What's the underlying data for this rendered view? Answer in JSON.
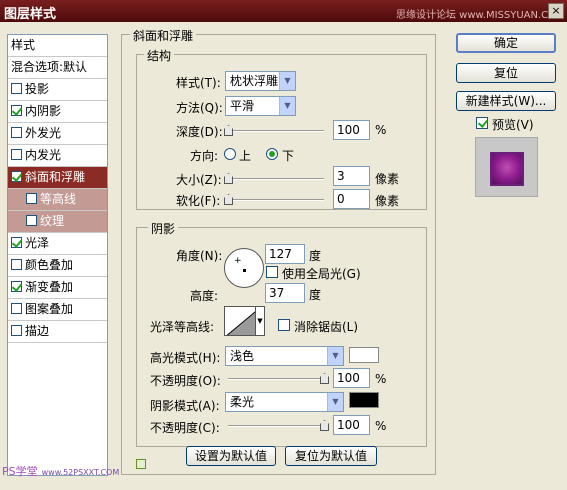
{
  "window": {
    "title": "图层样式",
    "watermark": "思缘设计论坛 www.MISSYUAN.COM",
    "close": "×"
  },
  "style_list": {
    "header": "样式",
    "blend_options": "混合选项:默认",
    "items": [
      {
        "label": "投影",
        "checked": false
      },
      {
        "label": "内阴影",
        "checked": true
      },
      {
        "label": "外发光",
        "checked": false
      },
      {
        "label": "内发光",
        "checked": false
      },
      {
        "label": "斜面和浮雕",
        "checked": true,
        "selected": true
      },
      {
        "label": "等高线",
        "checked": false,
        "sub": true
      },
      {
        "label": "纹理",
        "checked": false,
        "sub": true
      },
      {
        "label": "光泽",
        "checked": true
      },
      {
        "label": "颜色叠加",
        "checked": false
      },
      {
        "label": "渐变叠加",
        "checked": true
      },
      {
        "label": "图案叠加",
        "checked": false
      },
      {
        "label": "描边",
        "checked": false
      }
    ]
  },
  "bevel": {
    "section_title": "斜面和浮雕",
    "structure": {
      "title": "结构",
      "style_label": "样式(T):",
      "style_value": "枕状浮雕",
      "technique_label": "方法(Q):",
      "technique_value": "平滑",
      "depth_label": "深度(D):",
      "depth_value": "100",
      "depth_unit": "%",
      "depth_level": 0.0,
      "direction_label": "方向:",
      "direction_up": "上",
      "direction_down": "下",
      "direction_selected": "down",
      "size_label": "大小(Z):",
      "size_value": "3",
      "size_unit": "像素",
      "size_level": 0.0,
      "soften_label": "软化(F):",
      "soften_value": "0",
      "soften_unit": "像素",
      "soften_level": 0.0
    },
    "shading": {
      "title": "阴影",
      "angle_label": "角度(N):",
      "angle_value": "127",
      "angle_unit": "度",
      "global_light_label": "使用全局光(G)",
      "global_light_checked": false,
      "altitude_label": "高度:",
      "altitude_value": "37",
      "altitude_unit": "度",
      "gloss_contour_label": "光泽等高线:",
      "anti_alias_label": "消除锯齿(L)",
      "anti_alias_checked": false,
      "highlight_mode_label": "高光模式(H):",
      "highlight_mode_value": "浅色",
      "highlight_color": "#ffffff",
      "highlight_opacity_label": "不透明度(O):",
      "highlight_opacity_value": "100",
      "highlight_opacity_unit": "%",
      "highlight_opacity_level": 1.0,
      "shadow_mode_label": "阴影模式(A):",
      "shadow_mode_value": "柔光",
      "shadow_color": "#000000",
      "shadow_opacity_label": "不透明度(C):",
      "shadow_opacity_value": "100",
      "shadow_opacity_unit": "%",
      "shadow_opacity_level": 1.0
    },
    "make_default": "设置为默认值",
    "reset_default": "复位为默认值"
  },
  "buttons": {
    "ok": "确定",
    "reset": "复位",
    "new_style": "新建样式(W)...",
    "preview_label": "预览(V)",
    "preview_checked": true
  },
  "footer": {
    "brand": "PS学堂",
    "url": "www.52PSXXT.COM"
  }
}
